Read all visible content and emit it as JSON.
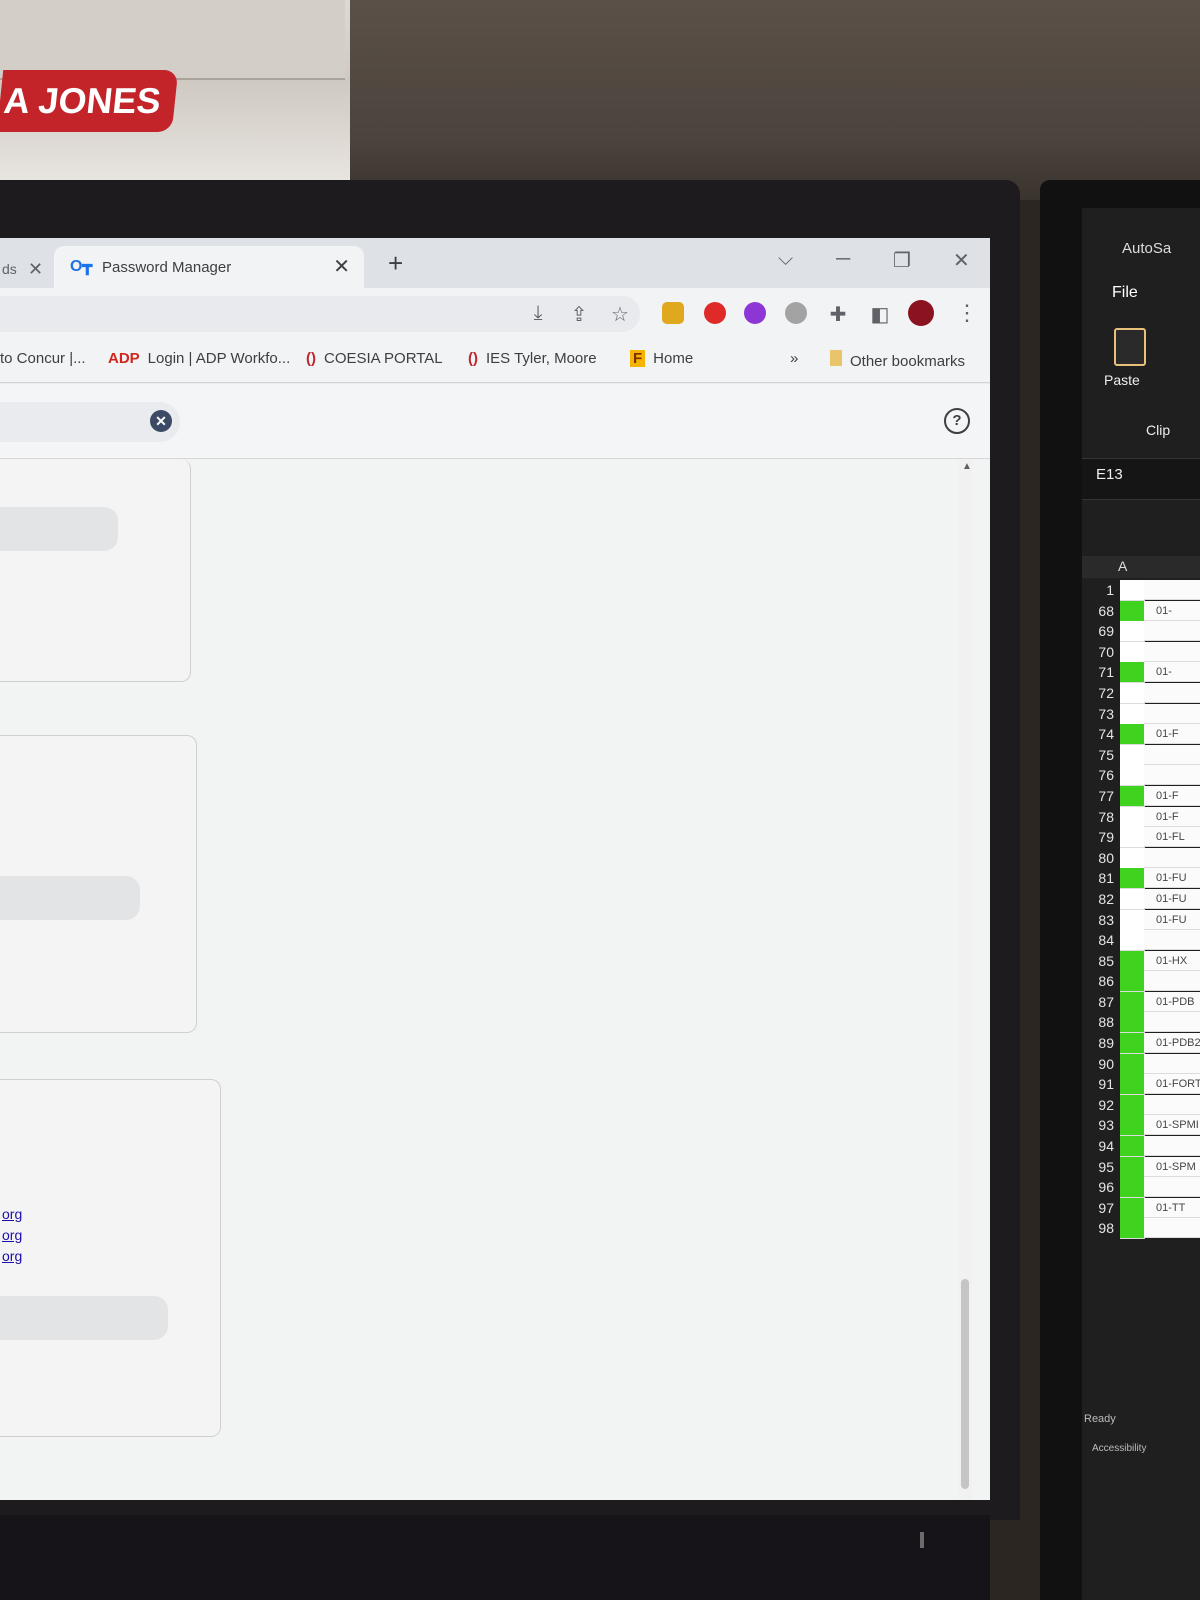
{
  "background": {
    "binder_label": "A JONES"
  },
  "browser": {
    "tabs": [
      {
        "label": "ds",
        "active": false
      },
      {
        "label": "Password Manager",
        "active": true
      }
    ],
    "new_tab": "+",
    "window_controls": {
      "dropdown": "⌵",
      "minimize": "─",
      "restore": "❐",
      "close": "✕"
    },
    "toolbar_icons": [
      "download-icon",
      "share-icon",
      "star-icon",
      "lock-extension-icon",
      "red-extension-icon",
      "purple-extension-icon",
      "grey-extension-icon",
      "puzzle-icon",
      "sidepanel-icon",
      "profile-avatar",
      "menu-icon"
    ],
    "bookmarks": [
      {
        "label": "to Concur |...",
        "icon": "concur-icon"
      },
      {
        "label": "Login | ADP Workfo...",
        "icon": "adp-icon"
      },
      {
        "label": "COESIA PORTAL",
        "icon": "coesia-icon"
      },
      {
        "label": "IES Tyler, Moore",
        "icon": "ies-icon"
      },
      {
        "label": "Home",
        "icon": "f-icon"
      }
    ],
    "more_bookmarks": "»",
    "other_bookmarks": "Other bookmarks"
  },
  "page": {
    "clear_symbol": "✕",
    "help_symbol": "?",
    "links": [
      "org",
      "org",
      "org"
    ]
  },
  "excel": {
    "autosave": "AutoSa",
    "file_tab": "File",
    "paste_label": "Paste",
    "clipboard_group": "Clip",
    "name_box": "E13",
    "column_a": "A",
    "rows": [
      {
        "num": "1",
        "green": false,
        "b": ""
      },
      {
        "num": "68",
        "green": true,
        "b": "01-"
      },
      {
        "num": "69",
        "green": false,
        "b": ""
      },
      {
        "num": "70",
        "green": false,
        "b": ""
      },
      {
        "num": "71",
        "green": true,
        "b": "01-"
      },
      {
        "num": "72",
        "green": false,
        "b": ""
      },
      {
        "num": "73",
        "green": false,
        "b": ""
      },
      {
        "num": "74",
        "green": true,
        "b": "01-F"
      },
      {
        "num": "75",
        "green": false,
        "b": ""
      },
      {
        "num": "76",
        "green": false,
        "b": ""
      },
      {
        "num": "77",
        "green": true,
        "b": "01-F"
      },
      {
        "num": "78",
        "green": false,
        "b": "01-F"
      },
      {
        "num": "79",
        "green": false,
        "b": "01-FL"
      },
      {
        "num": "80",
        "green": false,
        "b": ""
      },
      {
        "num": "81",
        "green": true,
        "b": "01-FU"
      },
      {
        "num": "82",
        "green": false,
        "b": "01-FU"
      },
      {
        "num": "83",
        "green": false,
        "b": "01-FU"
      },
      {
        "num": "84",
        "green": false,
        "b": ""
      },
      {
        "num": "85",
        "green": true,
        "b": "01-HX"
      },
      {
        "num": "86",
        "green": true,
        "b": ""
      },
      {
        "num": "87",
        "green": true,
        "b": "01-PDB"
      },
      {
        "num": "88",
        "green": true,
        "b": ""
      },
      {
        "num": "89",
        "green": true,
        "b": "01-PDB2"
      },
      {
        "num": "90",
        "green": true,
        "b": ""
      },
      {
        "num": "91",
        "green": true,
        "b": "01-FORTI"
      },
      {
        "num": "92",
        "green": true,
        "b": ""
      },
      {
        "num": "93",
        "green": true,
        "b": "01-SPMI"
      },
      {
        "num": "94",
        "green": true,
        "b": ""
      },
      {
        "num": "95",
        "green": true,
        "b": "01-SPM"
      },
      {
        "num": "96",
        "green": true,
        "b": ""
      },
      {
        "num": "97",
        "green": true,
        "b": "01-TT"
      },
      {
        "num": "98",
        "green": true,
        "b": ""
      }
    ],
    "status": "Ready",
    "accessibility": "Accessibility"
  }
}
